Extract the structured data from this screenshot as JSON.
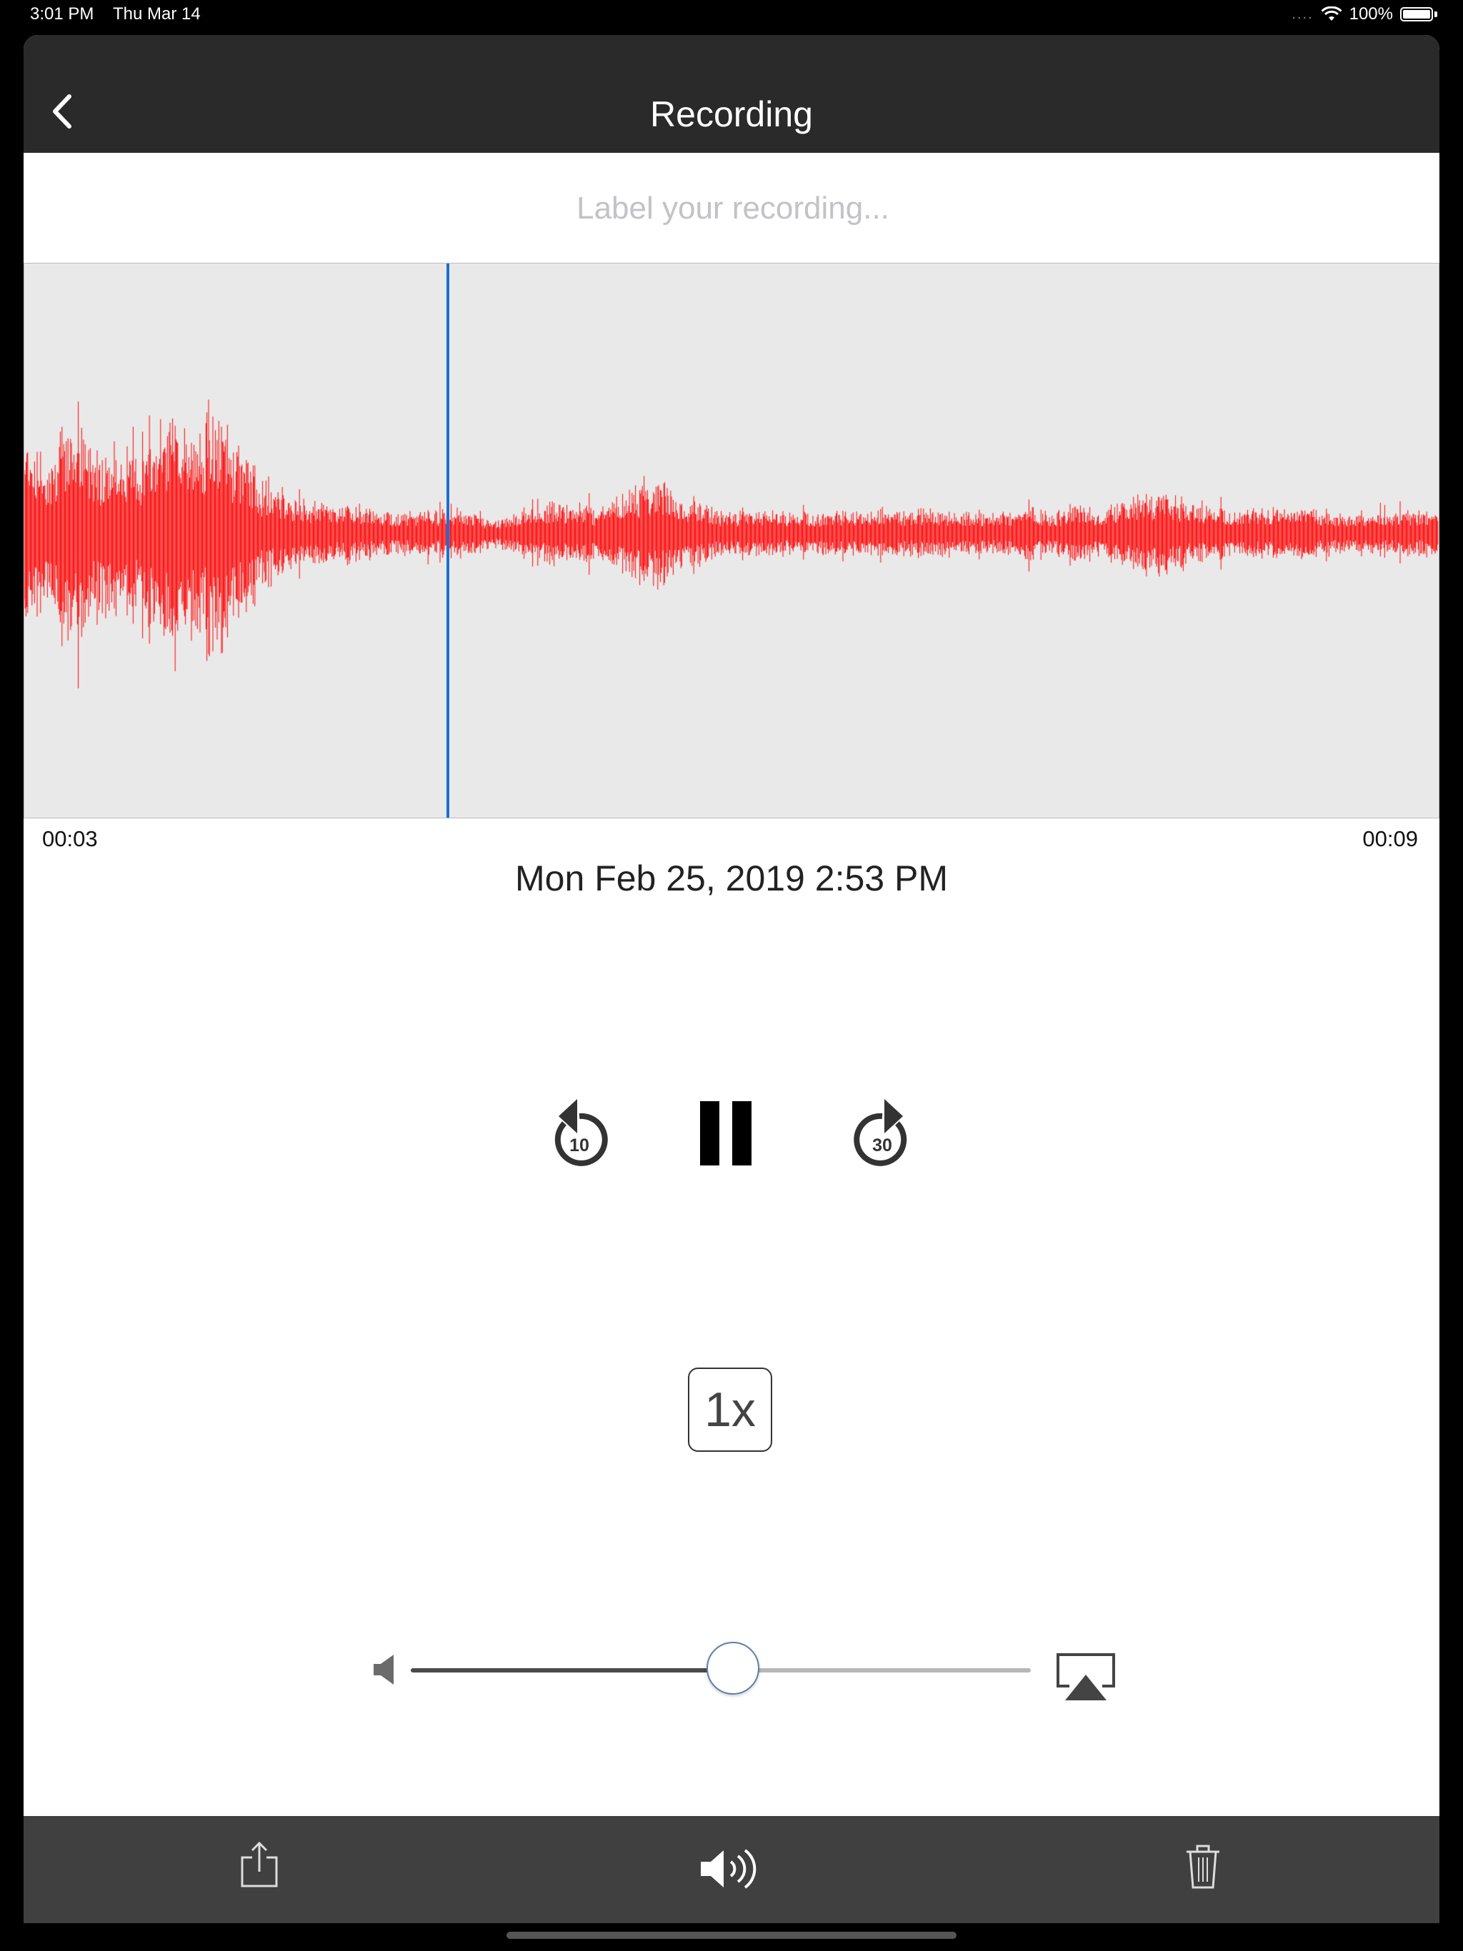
{
  "status_bar": {
    "time": "3:01 PM",
    "date": "Thu Mar 14",
    "signal": "....",
    "battery": "100%"
  },
  "nav": {
    "title": "Recording",
    "back_icon": "chevron-left-icon"
  },
  "label_input": {
    "value": "",
    "placeholder": "Label your recording..."
  },
  "waveform": {
    "start_time": "00:03",
    "end_time": "00:09",
    "wave_color": "#ff0000",
    "playhead_color": "#1d6fd1",
    "background_color": "#e9e9e9"
  },
  "recording_date": "Mon Feb 25, 2019 2:53 PM",
  "controls": {
    "rewind_seconds": "10",
    "forward_seconds": "30",
    "pause_icon": "pause-icon",
    "speed_label": "1x"
  },
  "volume": {
    "level": 0.52
  },
  "toolbar": {
    "share_icon": "share-icon",
    "speaker_icon": "speaker-icon",
    "trash_icon": "trash-icon"
  }
}
